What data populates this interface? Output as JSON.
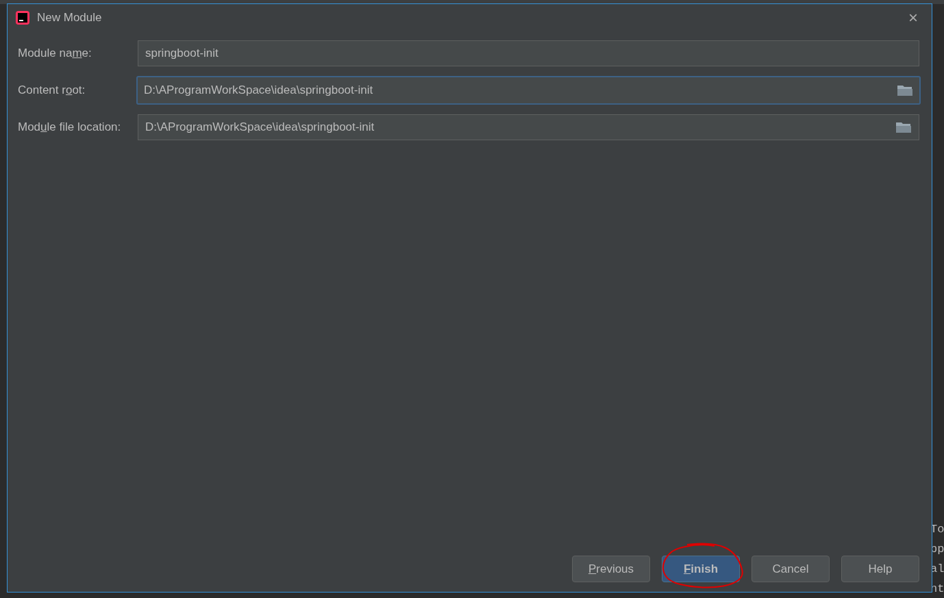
{
  "dialog": {
    "title": "New Module",
    "close_label": "×"
  },
  "fields": [
    {
      "label": {
        "before": "Module na",
        "mnemonic": "m",
        "after": "e:"
      },
      "value": "springboot-init",
      "focused": false,
      "browse": false
    },
    {
      "label": {
        "before": "Content r",
        "mnemonic": "o",
        "after": "ot:"
      },
      "value": "D:\\AProgramWorkSpace\\idea\\springboot-init",
      "focused": true,
      "browse": true
    },
    {
      "label": {
        "before": "Mod",
        "mnemonic": "u",
        "after": "le file location:"
      },
      "value": "D:\\AProgramWorkSpace\\idea\\springboot-init",
      "focused": false,
      "browse": true
    }
  ],
  "buttons": [
    {
      "label": {
        "mnemonic": "P",
        "after": "revious"
      },
      "default": false
    },
    {
      "label": {
        "mnemonic": "F",
        "after": "inish"
      },
      "default": true
    },
    {
      "label": {
        "before": "Cancel"
      },
      "default": false
    },
    {
      "label": {
        "before": "Help"
      },
      "default": false
    }
  ],
  "background_console": {
    "lines": [
      "To",
      "pp",
      "al",
      "nt"
    ]
  }
}
